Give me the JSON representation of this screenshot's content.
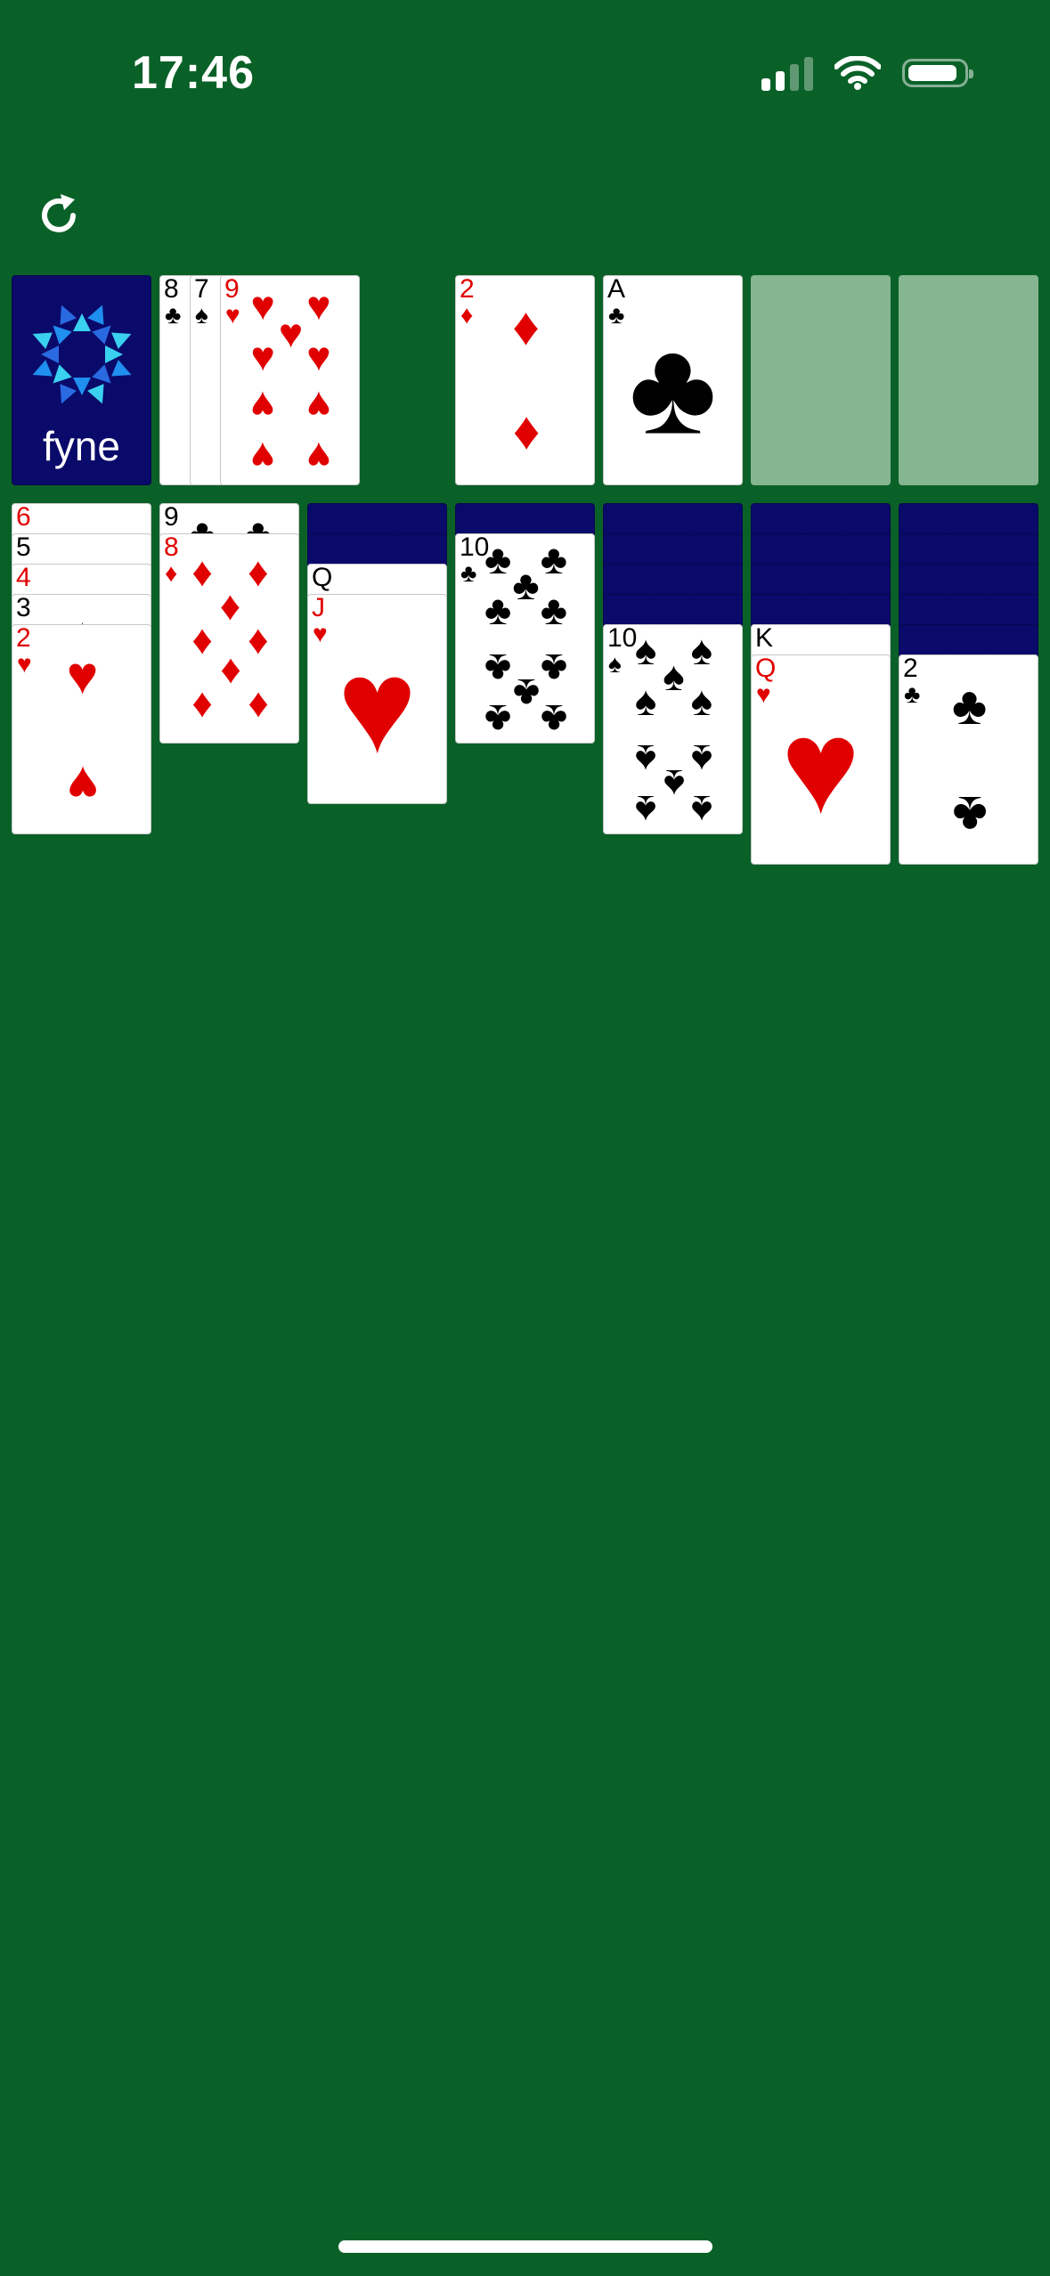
{
  "status_bar": {
    "time": "17:46"
  },
  "colors": {
    "felt": "#0a6128",
    "card_back": "#0a0a6a",
    "empty_slot": "#86b591",
    "red_suit": "#e10000",
    "black_suit": "#000000"
  },
  "icons": {
    "refresh": "refresh-icon",
    "signal": "cellular-signal-icon",
    "wifi": "wifi-icon",
    "battery": "battery-icon"
  },
  "stock": {
    "label": "fyne",
    "logo": "fyne-logo"
  },
  "waste": [
    {
      "rank": "8",
      "suit": "♣",
      "color": "black"
    },
    {
      "rank": "7",
      "suit": "♠",
      "color": "black"
    },
    {
      "rank": "9",
      "suit": "♥",
      "color": "red"
    }
  ],
  "foundations": [
    {
      "rank": "2",
      "suit": "♦",
      "color": "red"
    },
    {
      "rank": "A",
      "suit": "♣",
      "color": "black"
    },
    {
      "rank": "",
      "suit": "",
      "color": ""
    },
    {
      "rank": "",
      "suit": "",
      "color": ""
    }
  ],
  "tableau": [
    {
      "hidden": 0,
      "cards": [
        {
          "rank": "6",
          "suit": "♥",
          "color": "red"
        },
        {
          "rank": "5",
          "suit": "♠",
          "color": "black"
        },
        {
          "rank": "4",
          "suit": "♥",
          "color": "red"
        },
        {
          "rank": "3",
          "suit": "♠",
          "color": "black"
        },
        {
          "rank": "2",
          "suit": "♥",
          "color": "red"
        }
      ]
    },
    {
      "hidden": 0,
      "cards": [
        {
          "rank": "9",
          "suit": "♣",
          "color": "black"
        },
        {
          "rank": "8",
          "suit": "♦",
          "color": "red"
        }
      ]
    },
    {
      "hidden": 2,
      "cards": [
        {
          "rank": "Q",
          "suit": "♠",
          "color": "black"
        },
        {
          "rank": "J",
          "suit": "♥",
          "color": "red"
        }
      ]
    },
    {
      "hidden": 1,
      "cards": [
        {
          "rank": "10",
          "suit": "♣",
          "color": "black"
        }
      ]
    },
    {
      "hidden": 4,
      "cards": [
        {
          "rank": "10",
          "suit": "♠",
          "color": "black"
        }
      ]
    },
    {
      "hidden": 4,
      "cards": [
        {
          "rank": "K",
          "suit": "♠",
          "color": "black"
        },
        {
          "rank": "Q",
          "suit": "♥",
          "color": "red"
        }
      ]
    },
    {
      "hidden": 5,
      "cards": [
        {
          "rank": "2",
          "suit": "♣",
          "color": "black"
        }
      ]
    }
  ]
}
